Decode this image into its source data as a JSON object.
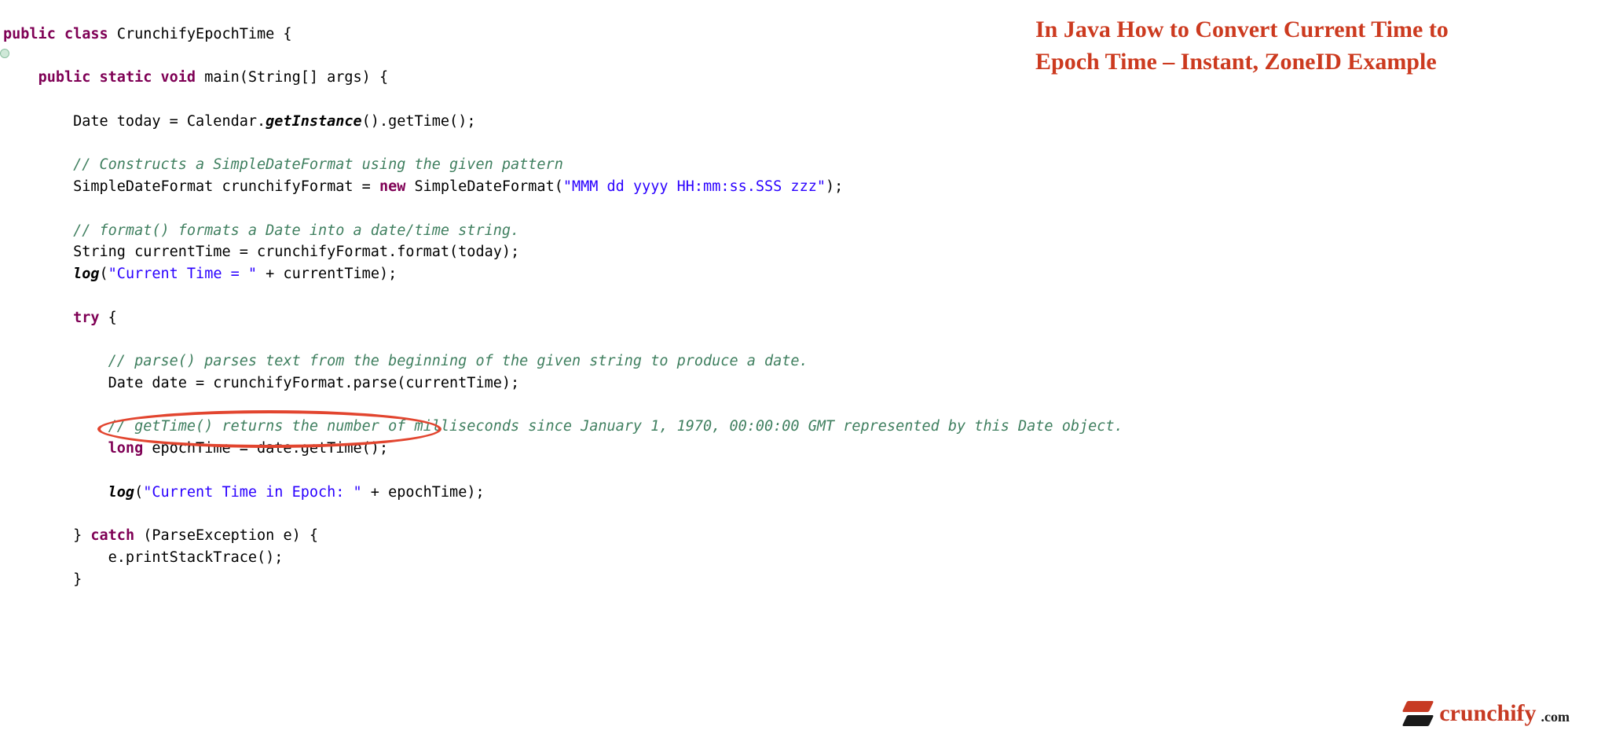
{
  "title": {
    "line1": "In Java How to Convert Current Time to",
    "line2": "Epoch Time – Instant, ZoneID Example"
  },
  "code": {
    "l1_kw1": "public",
    "l1_kw2": "class",
    "l1_cls": "CrunchifyEpochTime",
    "l1_tail": " {",
    "l2_kw1": "public",
    "l2_kw2": "static",
    "l2_kw3": "void",
    "l2_sig": " main(String[] args) {",
    "l3_a": "        Date today = Calendar.",
    "l3_m": "getInstance",
    "l3_b": "().getTime();",
    "l4_c": "        // Constructs a SimpleDateFormat using the given pattern",
    "l5_a": "        SimpleDateFormat crunchifyFormat = ",
    "l5_kw": "new",
    "l5_b": " SimpleDateFormat(",
    "l5_s": "\"MMM dd yyyy HH:mm:ss.SSS zzz\"",
    "l5_c": ");",
    "l6_c": "        // format() formats a Date into a date/time string.",
    "l7": "        String currentTime = crunchifyFormat.format(today);",
    "l8_a": "        ",
    "l8_m": "log",
    "l8_b": "(",
    "l8_s": "\"Current Time = \"",
    "l8_c": " + currentTime);",
    "l9_a": "        ",
    "l9_kw": "try",
    "l9_b": " {",
    "l10_c": "            // parse() parses text from the beginning of the given string to produce a date.",
    "l11": "            Date date = crunchifyFormat.parse(currentTime);",
    "l12_c": "            // getTime() returns the number of milliseconds since January 1, 1970, 00:00:00 GMT represented by this Date object.",
    "l13_a": "            ",
    "l13_kw": "long",
    "l13_b": " epochTime = date.getTime();",
    "l14_a": "            ",
    "l14_m": "log",
    "l14_b": "(",
    "l14_s": "\"Current Time in Epoch: \"",
    "l14_c": " + epochTime);",
    "l15_a": "        } ",
    "l15_kw": "catch",
    "l15_b": " (ParseException e) {",
    "l16": "            e.printStackTrace();",
    "l17": "        }"
  },
  "logo": {
    "brand": "crunchify",
    "suffix": ".com"
  }
}
